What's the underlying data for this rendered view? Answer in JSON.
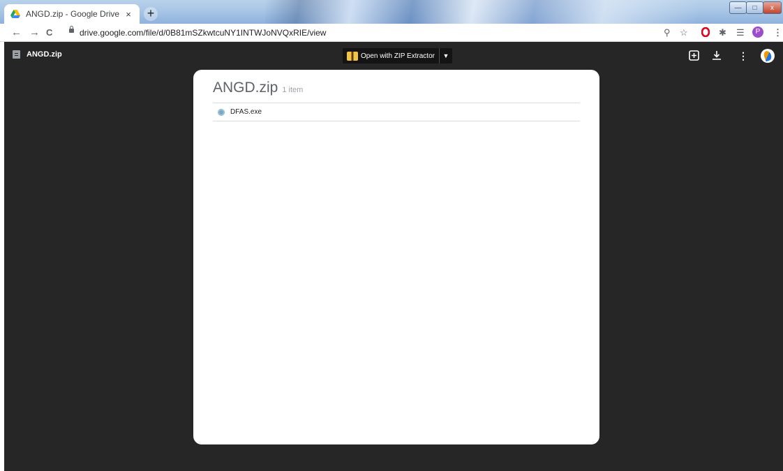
{
  "browser": {
    "tab": {
      "title": "ANGD.zip - Google Drive",
      "close": "×"
    },
    "newtab": "+",
    "url": "drive.google.com/file/d/0B81mSZkwtcuNY1INTWJoNVQxRIE/view",
    "nav": {
      "back": "←",
      "forward": "→",
      "reload": "C"
    },
    "toolbar_icons": {
      "zoom": "⚲",
      "star": "☆",
      "extension": "✱",
      "media": "☰"
    },
    "profile_initial": "P",
    "window_controls": {
      "minimize": "—",
      "maximize": "□",
      "close": "x"
    }
  },
  "viewer": {
    "filename": "ANGD.zip",
    "open_with": "Open with ZIP Extractor",
    "zip": {
      "name": "ANGD.zip",
      "count": "1 item",
      "items": [
        {
          "name": "DFAS.exe"
        }
      ]
    }
  }
}
